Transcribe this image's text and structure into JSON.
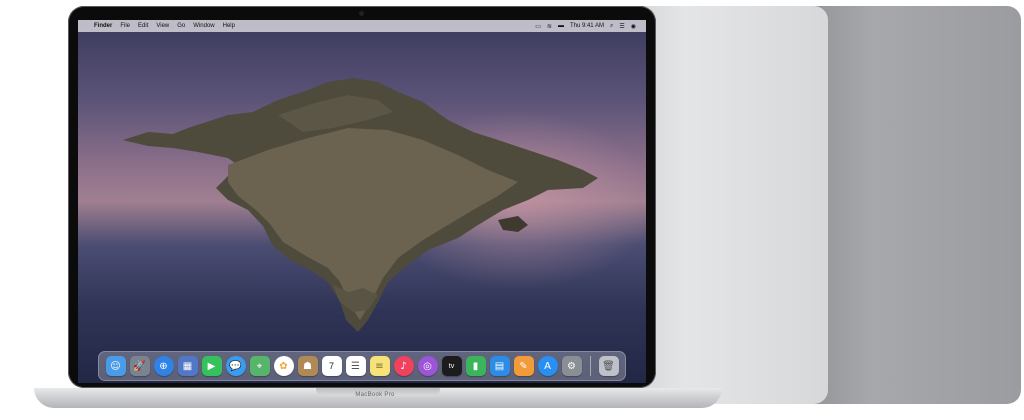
{
  "menubar": {
    "apple_icon": "apple-logo-icon",
    "items": [
      "Finder",
      "File",
      "Edit",
      "View",
      "Go",
      "Window",
      "Help"
    ],
    "time": "Thu 9:41 AM"
  },
  "dock": {
    "apps": [
      {
        "name": "Finder",
        "icon": "finder-icon",
        "color": "#4a9be8"
      },
      {
        "name": "Launchpad",
        "icon": "rocket-icon",
        "color": "#7a8490"
      },
      {
        "name": "Safari",
        "icon": "compass-icon",
        "color": "#2f83e6"
      },
      {
        "name": "Photo",
        "icon": "photo-icon",
        "color": "#5277c7"
      },
      {
        "name": "FaceTime",
        "icon": "video-camera-icon",
        "color": "#35c25c"
      },
      {
        "name": "Messages",
        "icon": "message-bubble-icon",
        "color": "#3a9cf0"
      },
      {
        "name": "Maps",
        "icon": "map-icon",
        "color": "#56b46b"
      },
      {
        "name": "Photos",
        "icon": "flower-icon",
        "color": "#f0a63a"
      },
      {
        "name": "Contacts",
        "icon": "contacts-book-icon",
        "color": "#b08a56"
      },
      {
        "name": "Calendar",
        "icon": "calendar-icon",
        "color": "#ffffff"
      },
      {
        "name": "Reminders",
        "icon": "checklist-icon",
        "color": "#ffffff"
      },
      {
        "name": "Notes",
        "icon": "note-icon",
        "color": "#f7e27a"
      },
      {
        "name": "Music",
        "icon": "music-note-icon",
        "color": "#f0415f"
      },
      {
        "name": "Podcasts",
        "icon": "podcast-icon",
        "color": "#9b55d6"
      },
      {
        "name": "TV",
        "icon": "tv-icon",
        "color": "#1c1c1e"
      },
      {
        "name": "Numbers",
        "icon": "bar-chart-icon",
        "color": "#3bb55c"
      },
      {
        "name": "Keynote",
        "icon": "keynote-icon",
        "color": "#2d8ce6"
      },
      {
        "name": "Pages",
        "icon": "pen-icon",
        "color": "#f29b38"
      },
      {
        "name": "App Store",
        "icon": "app-store-icon",
        "color": "#2a8ff2"
      },
      {
        "name": "System Preferences",
        "icon": "gear-icon",
        "color": "#8a8e95"
      }
    ],
    "trash_icon": "trash-icon"
  },
  "calendar_day": "7",
  "tv_label": "tv",
  "model_name": "MacBook Pro",
  "colors": {
    "space_gray": "#9b9c9f",
    "silver": "#dcdddf",
    "bezel": "#0b0b0c"
  }
}
